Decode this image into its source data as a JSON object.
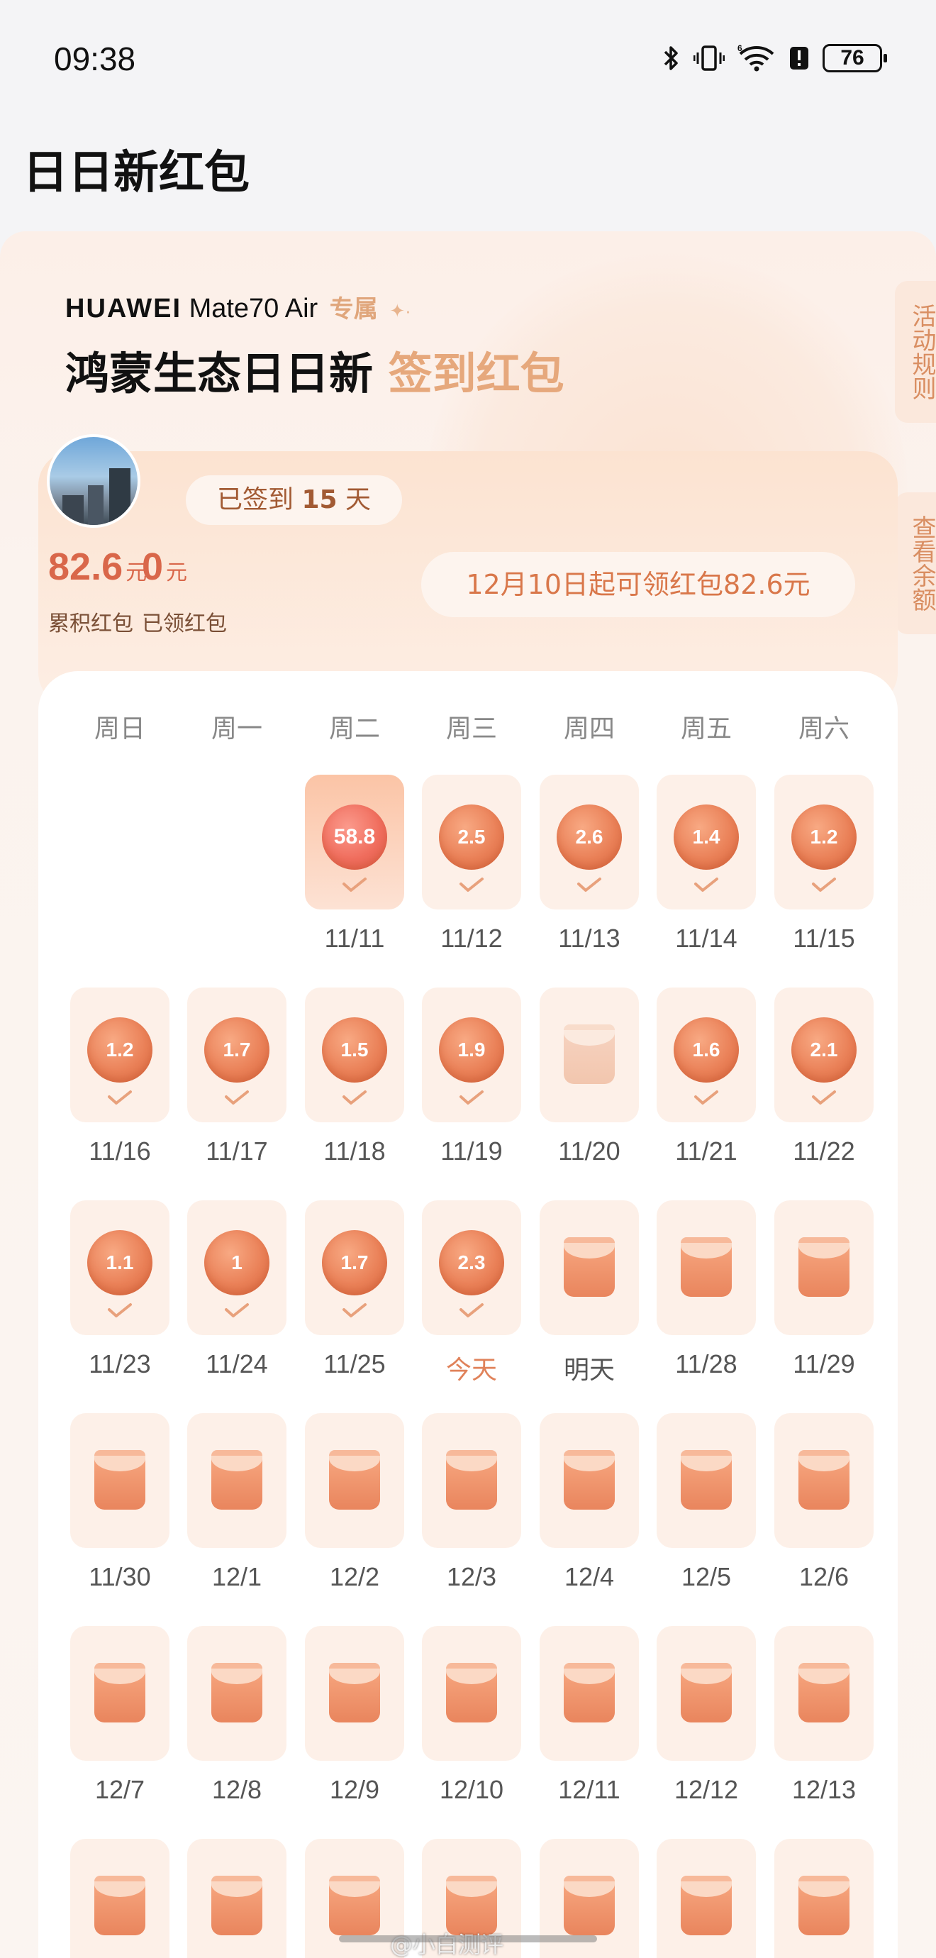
{
  "status_bar": {
    "time": "09:38",
    "battery": "76"
  },
  "page_title": "日日新红包",
  "banner": {
    "brand": "HUAWEI",
    "model": "Mate70 Air",
    "exclusive": "专属",
    "headline_main": "鸿蒙生态日日新",
    "headline_accent": "签到红包"
  },
  "side_tabs": {
    "rules": "活动规则",
    "balance": "查看余额"
  },
  "summary": {
    "days_prefix": "已签到",
    "days_count": "15",
    "days_suffix": "天",
    "accumulated_value": "82.6",
    "accumulated_unit": "元",
    "accumulated_label": "累积红包",
    "claimed_value": "0",
    "claimed_unit": "元",
    "claimed_label": "已领红包",
    "notice": "12月10日起可领红包82.6元"
  },
  "weekdays": [
    "周日",
    "周一",
    "周二",
    "周三",
    "周四",
    "周五",
    "周六"
  ],
  "calendar_rows": [
    [
      null,
      {
        "label": "11/11",
        "state": "claimed",
        "amount": "58.8",
        "big": true
      },
      {
        "label": "11/12",
        "state": "claimed",
        "amount": "2.5"
      },
      {
        "label": "11/13",
        "state": "claimed",
        "amount": "2.6"
      },
      {
        "label": "11/14",
        "state": "claimed",
        "amount": "1.4"
      },
      {
        "label": "11/15",
        "state": "claimed",
        "amount": "1.2"
      }
    ],
    [
      {
        "label": "11/16",
        "state": "claimed",
        "amount": "1.2"
      },
      {
        "label": "11/17",
        "state": "claimed",
        "amount": "1.7"
      },
      {
        "label": "11/18",
        "state": "claimed",
        "amount": "1.5"
      },
      {
        "label": "11/19",
        "state": "claimed",
        "amount": "1.9"
      },
      {
        "label": "11/20",
        "state": "missed"
      },
      {
        "label": "11/21",
        "state": "claimed",
        "amount": "1.6"
      },
      {
        "label": "11/22",
        "state": "claimed",
        "amount": "2.1"
      }
    ],
    [
      {
        "label": "11/23",
        "state": "claimed",
        "amount": "1.1"
      },
      {
        "label": "11/24",
        "state": "claimed",
        "amount": "1"
      },
      {
        "label": "11/25",
        "state": "claimed",
        "amount": "1.7"
      },
      {
        "label": "今天",
        "state": "claimed",
        "amount": "2.3",
        "today": true
      },
      {
        "label": "明天",
        "state": "pending",
        "tomorrow": true
      },
      {
        "label": "11/28",
        "state": "pending"
      },
      {
        "label": "11/29",
        "state": "pending"
      }
    ],
    [
      {
        "label": "11/30",
        "state": "pending"
      },
      {
        "label": "12/1",
        "state": "pending"
      },
      {
        "label": "12/2",
        "state": "pending"
      },
      {
        "label": "12/3",
        "state": "pending"
      },
      {
        "label": "12/4",
        "state": "pending"
      },
      {
        "label": "12/5",
        "state": "pending"
      },
      {
        "label": "12/6",
        "state": "pending"
      }
    ],
    [
      {
        "label": "12/7",
        "state": "pending"
      },
      {
        "label": "12/8",
        "state": "pending"
      },
      {
        "label": "12/9",
        "state": "pending"
      },
      {
        "label": "12/10",
        "state": "pending"
      },
      {
        "label": "12/11",
        "state": "pending"
      },
      {
        "label": "12/12",
        "state": "pending"
      },
      {
        "label": "12/13",
        "state": "pending"
      }
    ],
    [
      {
        "label": "",
        "state": "pending"
      },
      {
        "label": "",
        "state": "pending"
      },
      {
        "label": "",
        "state": "pending"
      },
      {
        "label": "",
        "state": "pending"
      },
      {
        "label": "",
        "state": "pending"
      },
      {
        "label": "",
        "state": "pending"
      },
      {
        "label": "",
        "state": "pending"
      }
    ]
  ],
  "watermark": "@小白测评",
  "colors": {
    "accent": "#e6a87c",
    "coin": "#ea8158",
    "amount": "#d9674a"
  }
}
